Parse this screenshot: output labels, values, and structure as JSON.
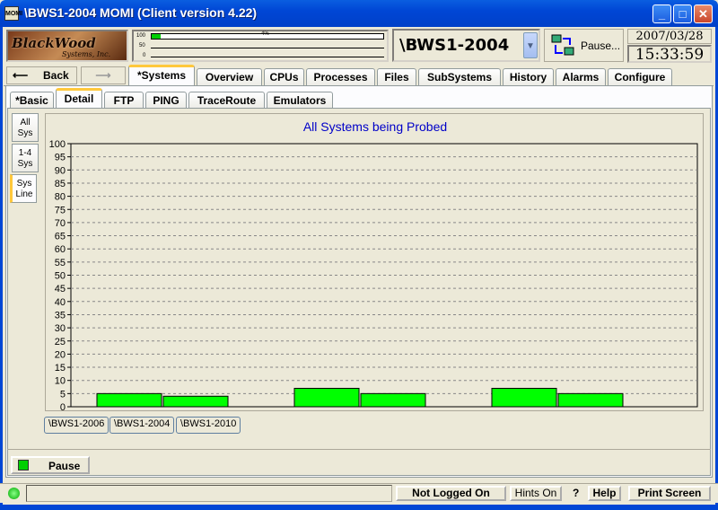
{
  "window": {
    "title": "\\BWS1-2004 MOMI (Client version 4.22)",
    "app_icon": "MOMI"
  },
  "logo": {
    "name": "BlackWood",
    "sub": "Systems, Inc."
  },
  "meter": {
    "labels": [
      "100",
      "50",
      "0"
    ],
    "percent_label": "4%",
    "fill_percent": 4
  },
  "system_select": {
    "value": "\\BWS1-2004"
  },
  "pause_top": {
    "label": "Pause..."
  },
  "clock": {
    "date": "2007/03/28",
    "time": "15:33:59"
  },
  "nav": {
    "back_label": "Back"
  },
  "main_tabs": [
    "*Systems",
    "Overview",
    "CPUs",
    "Processes",
    "Files",
    "SubSystems",
    "History",
    "Alarms",
    "Configure"
  ],
  "sub_tabs": [
    "*Basic",
    "Detail",
    "FTP",
    "PING",
    "TraceRoute",
    "Emulators"
  ],
  "side_tabs": [
    [
      "All",
      "Sys"
    ],
    [
      "1-4",
      "Sys"
    ],
    [
      "Sys",
      "Line"
    ]
  ],
  "chart_data": {
    "type": "bar",
    "title": "All Systems being Probed",
    "ylim": [
      0,
      100
    ],
    "yticks": [
      0,
      5,
      10,
      15,
      20,
      25,
      30,
      35,
      40,
      45,
      50,
      55,
      60,
      65,
      70,
      75,
      80,
      85,
      90,
      95,
      100
    ],
    "grid": true,
    "categories": [
      "\\BWS1-2006",
      "\\BWS1-2004",
      "\\BWS1-2010"
    ],
    "series": [
      {
        "values": [
          5,
          7,
          7
        ]
      },
      {
        "values": [
          4,
          5,
          5
        ]
      }
    ],
    "bar_color": "#00ff00"
  },
  "pause_button": {
    "label": "Pause"
  },
  "status": {
    "login": "Not Logged On",
    "hints": "Hints On",
    "question": "?",
    "help": "Help",
    "print": "Print Screen"
  },
  "colors": {
    "titlebar": "#0046d5",
    "accent_tab": "#ffc83c",
    "chart_title": "#0000c8"
  }
}
